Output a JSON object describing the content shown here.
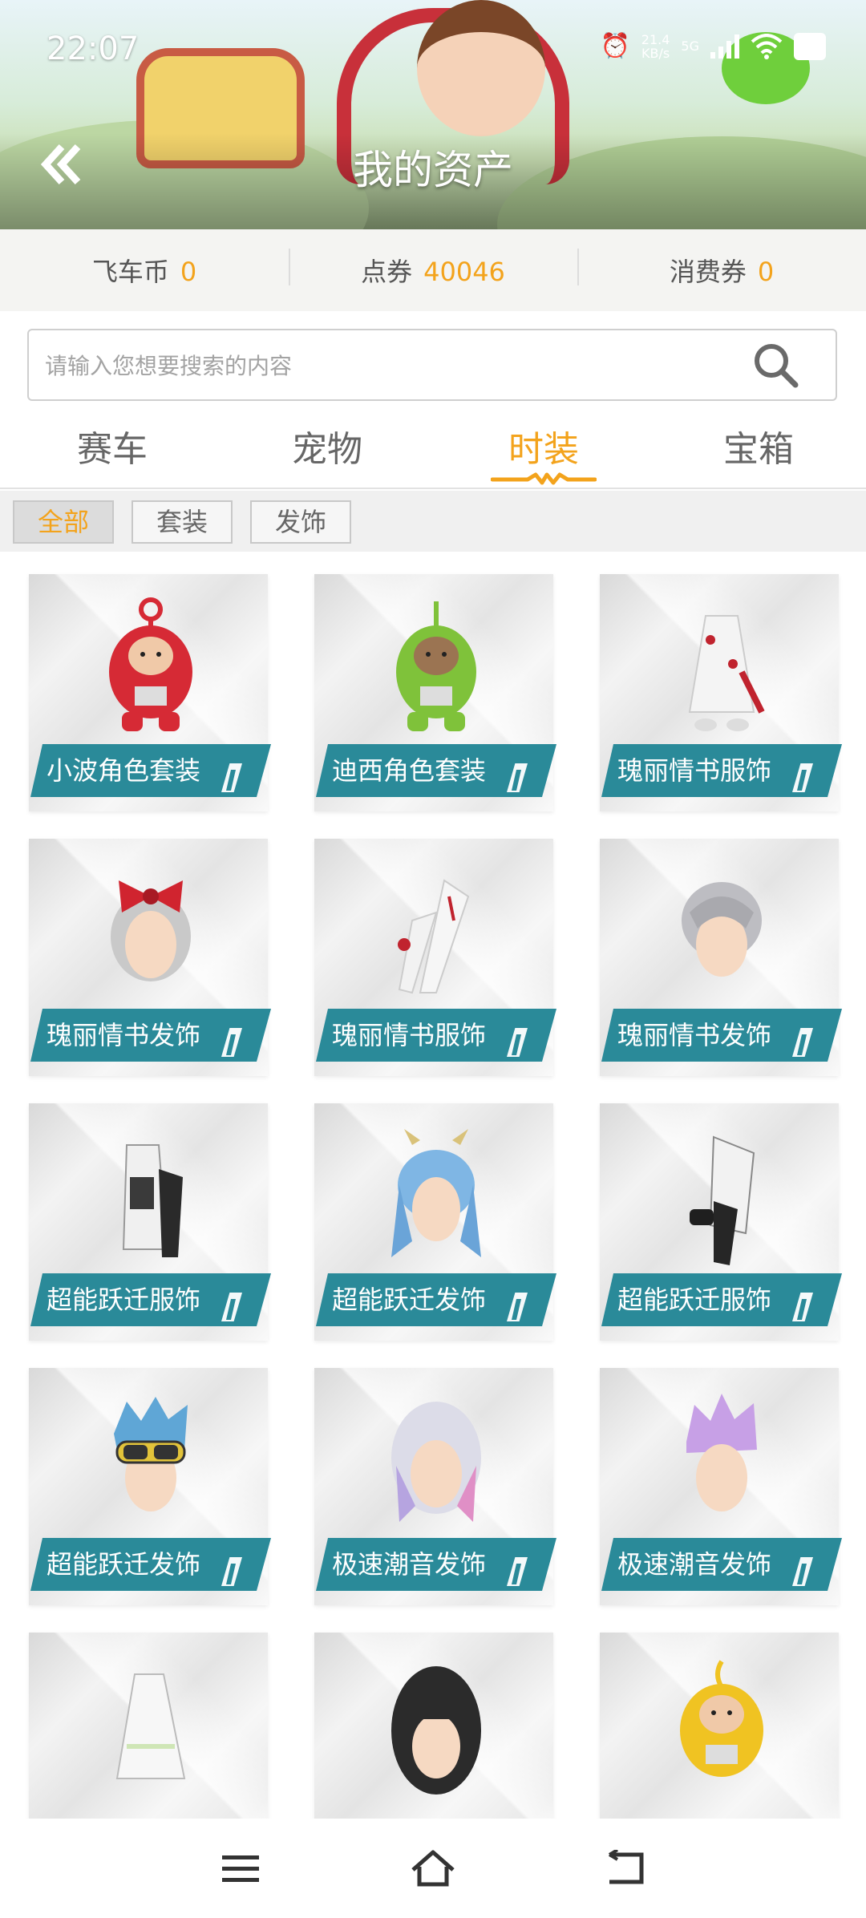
{
  "status_bar": {
    "time": "22:07",
    "net_speed": "21.4",
    "net_unit": "KB/s",
    "net_type": "5G"
  },
  "header": {
    "title": "我的资产"
  },
  "currency": [
    {
      "label": "飞车币",
      "value": "0"
    },
    {
      "label": "点券",
      "value": "40046"
    },
    {
      "label": "消费券",
      "value": "0"
    }
  ],
  "search": {
    "placeholder": "请输入您想要搜索的内容"
  },
  "tabs": [
    {
      "label": "赛车",
      "active": false
    },
    {
      "label": "宠物",
      "active": false
    },
    {
      "label": "时装",
      "active": true
    },
    {
      "label": "宝箱",
      "active": false
    }
  ],
  "filters": [
    {
      "label": "全部",
      "active": true
    },
    {
      "label": "套装",
      "active": false
    },
    {
      "label": "发饰",
      "active": false
    }
  ],
  "items": [
    {
      "name": "小波角色套装",
      "icon": "red-teletubby-icon"
    },
    {
      "name": "迪西角色套装",
      "icon": "green-teletubby-icon"
    },
    {
      "name": "瑰丽情书服饰",
      "icon": "white-dress-icon"
    },
    {
      "name": "瑰丽情书发饰",
      "icon": "red-bow-hair-icon"
    },
    {
      "name": "瑰丽情书服饰",
      "icon": "white-suit-icon"
    },
    {
      "name": "瑰丽情书发饰",
      "icon": "silver-hair-icon"
    },
    {
      "name": "超能跃迁服饰",
      "icon": "black-white-outfit-icon"
    },
    {
      "name": "超能跃迁发饰",
      "icon": "blue-twin-tail-hair-icon"
    },
    {
      "name": "超能跃迁服饰",
      "icon": "black-coat-outfit-icon"
    },
    {
      "name": "超能跃迁发饰",
      "icon": "goggles-blue-hair-icon"
    },
    {
      "name": "极速潮音发饰",
      "icon": "silver-long-hair-icon"
    },
    {
      "name": "极速潮音发饰",
      "icon": "purple-spiky-hair-icon"
    },
    {
      "name": "",
      "icon": "lace-dress-icon"
    },
    {
      "name": "",
      "icon": "black-long-hair-icon"
    },
    {
      "name": "",
      "icon": "yellow-teletubby-icon"
    }
  ],
  "colors": {
    "accent": "#f3a31c",
    "label_bg": "#2a8a99",
    "title": "#ffffff"
  }
}
